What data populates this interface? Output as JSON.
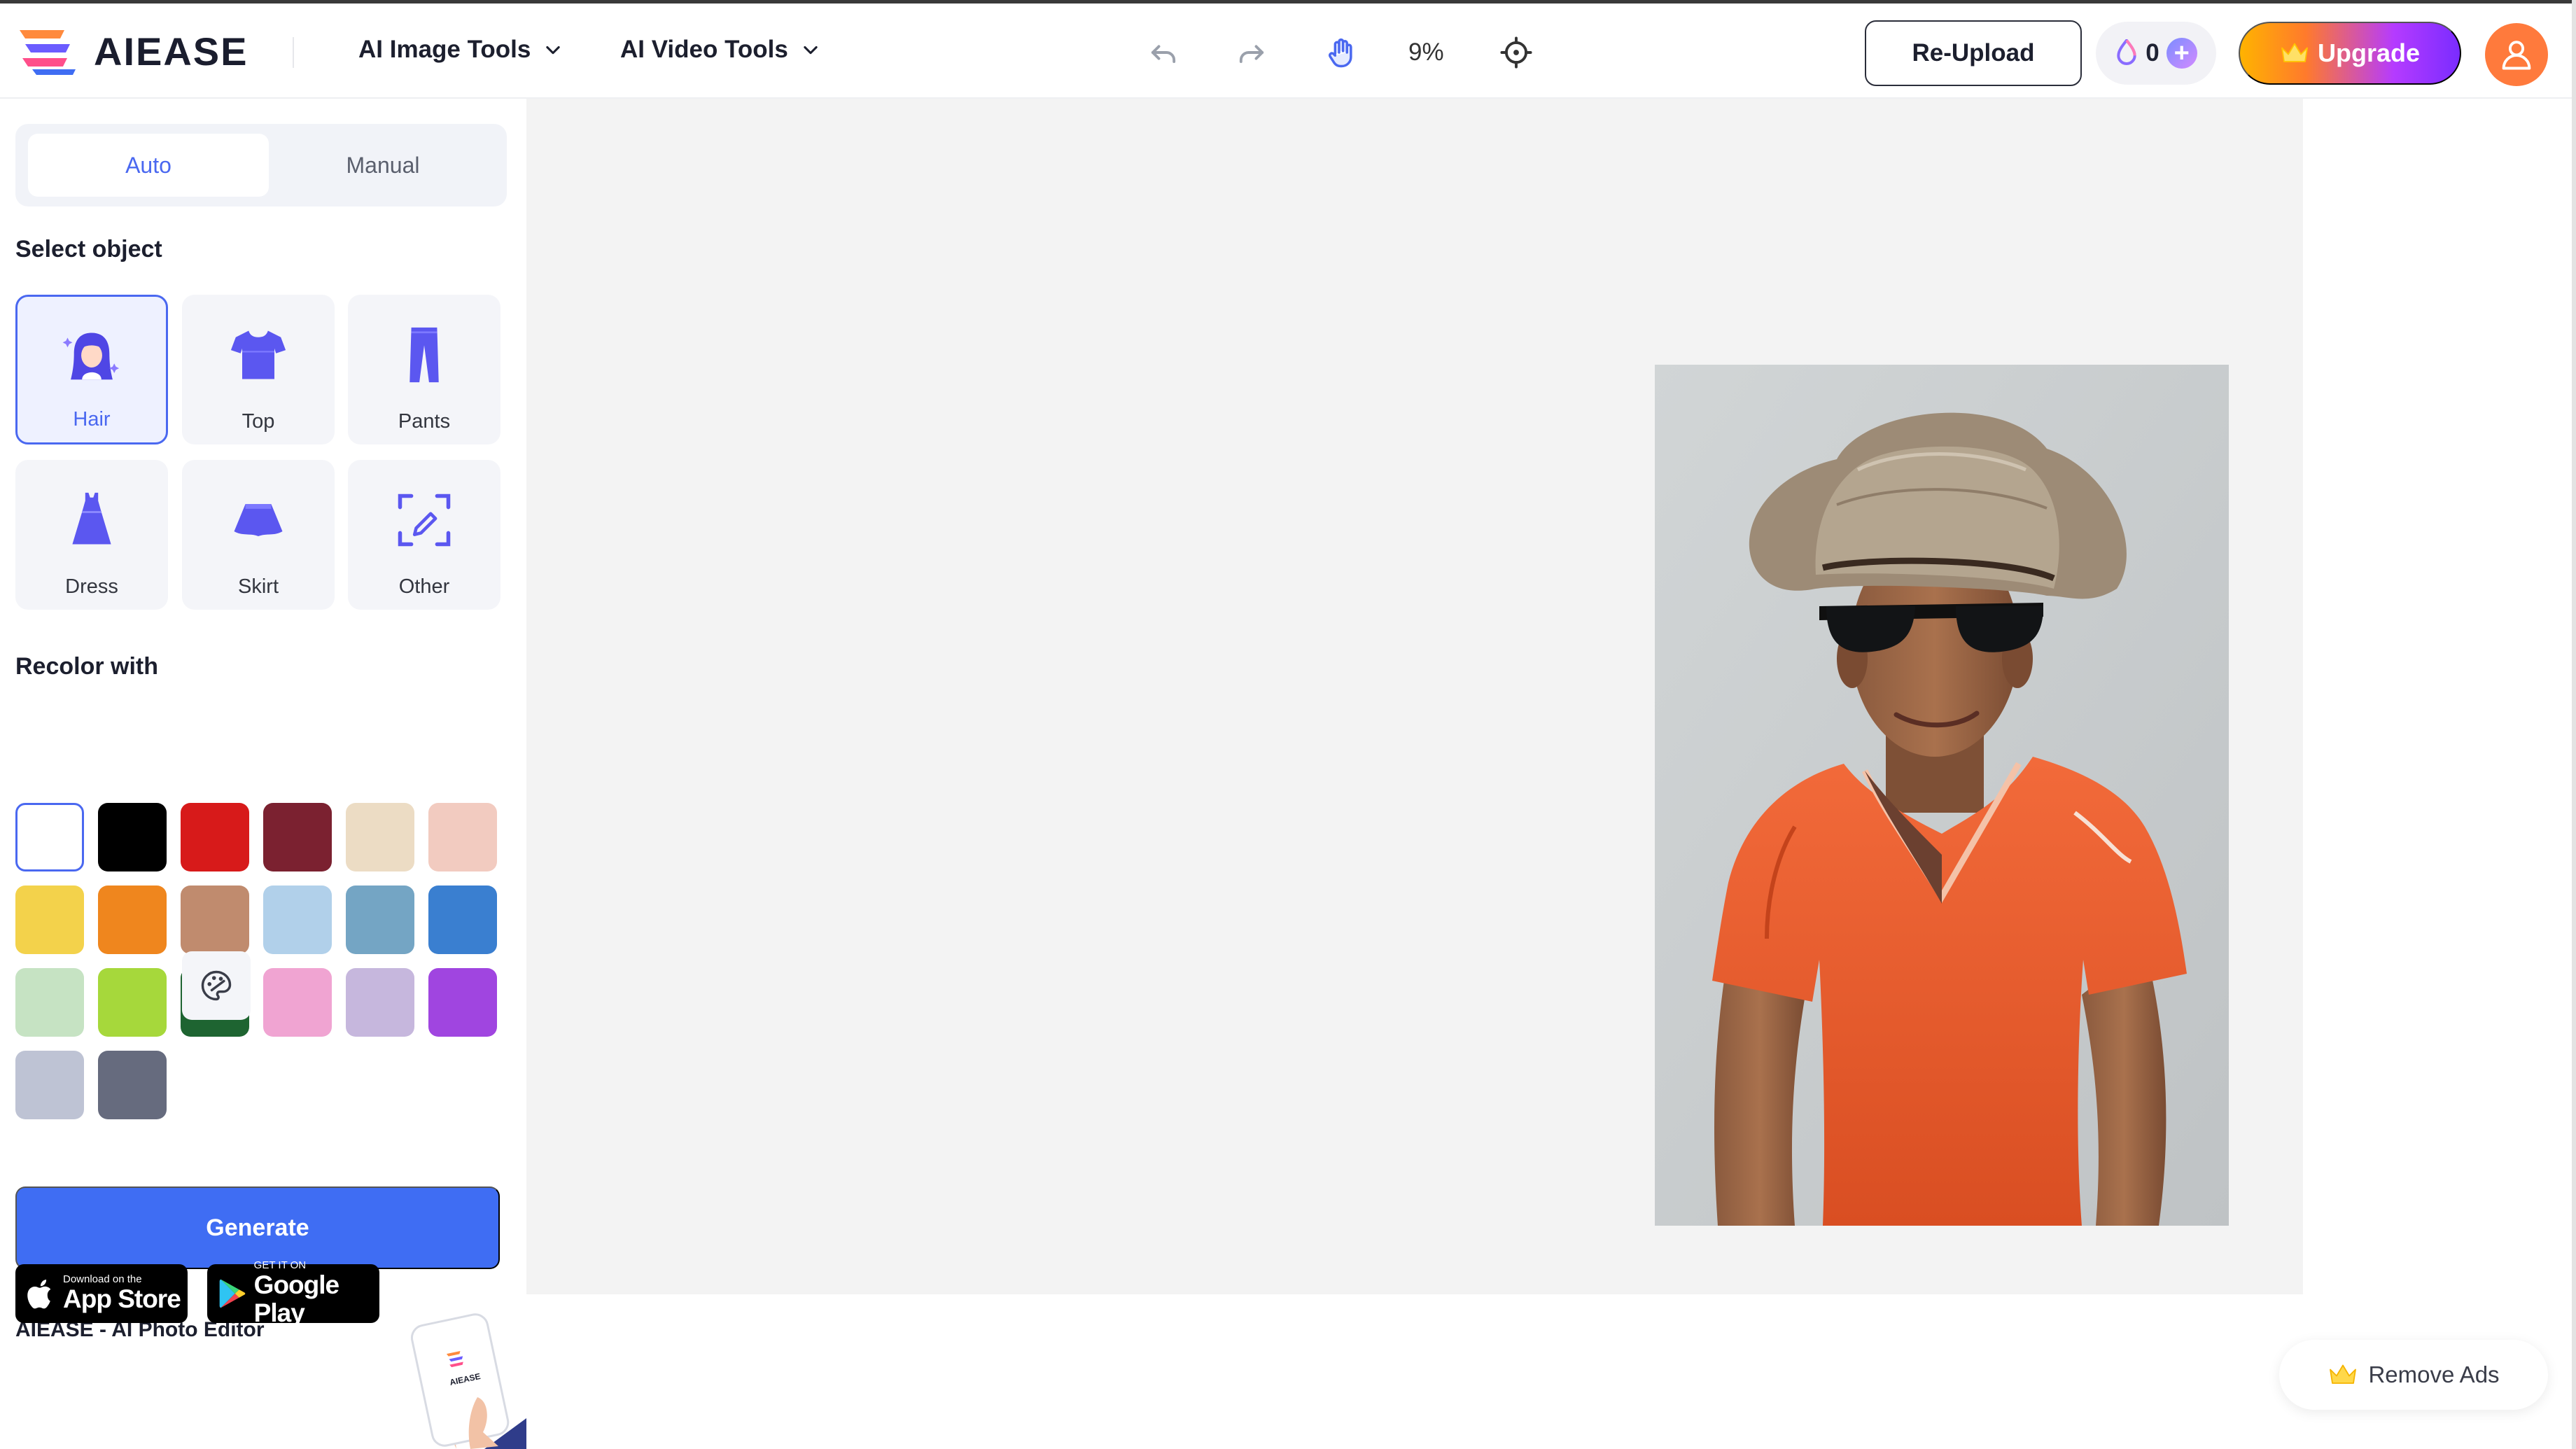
{
  "header": {
    "brand": "AIEASE",
    "menu": [
      {
        "label": "AI Image Tools"
      },
      {
        "label": "AI Video Tools"
      }
    ],
    "toolbar": {
      "undo_icon": "undo-icon",
      "redo_icon": "redo-icon",
      "hand_icon": "hand-icon",
      "zoom": "9%",
      "recenter_icon": "crosshair-icon"
    },
    "reupload_label": "Re-Upload",
    "credits": "0",
    "upgrade_label": "Upgrade"
  },
  "sidebar": {
    "modes": [
      {
        "label": "Auto",
        "active": true
      },
      {
        "label": "Manual",
        "active": false
      }
    ],
    "select_object_title": "Select object",
    "objects": [
      {
        "label": "Hair",
        "icon": "hair-icon",
        "selected": true
      },
      {
        "label": "Top",
        "icon": "shirt-icon",
        "selected": false
      },
      {
        "label": "Pants",
        "icon": "pants-icon",
        "selected": false
      },
      {
        "label": "Dress",
        "icon": "dress-icon",
        "selected": false
      },
      {
        "label": "Skirt",
        "icon": "skirt-icon",
        "selected": false
      },
      {
        "label": "Other",
        "icon": "edit-select-icon",
        "selected": false
      }
    ],
    "recolor_title": "Recolor with",
    "colors": [
      "#ffffff",
      "#000000",
      "#d71a1a",
      "#7b2130",
      "#ecdcc4",
      "#f2cbc0",
      "#f3d24b",
      "#ef861e",
      "#c08b6e",
      "#b1d0ea",
      "#74a5c4",
      "#3a7fd0",
      "#c6e3c3",
      "#a6d83b",
      "#1e6431",
      "#f0a4d2",
      "#c6b7dd",
      "#a045e0",
      "#bec3d4",
      "#666b7e"
    ],
    "selected_color": "#ffffff",
    "palette_icon": "palette-icon",
    "generate_label": "Generate",
    "app_title": "AIEASE - AI Photo Editor",
    "app_store": {
      "small": "Download on the",
      "big": "App Store"
    },
    "google_play": {
      "small": "GET IT ON",
      "big": "Google Play"
    }
  },
  "remove_ads_label": "Remove Ads",
  "colors": {
    "accent": "#4a68f0",
    "generate": "#3f6df3",
    "avatar": "#ff7a3c"
  }
}
